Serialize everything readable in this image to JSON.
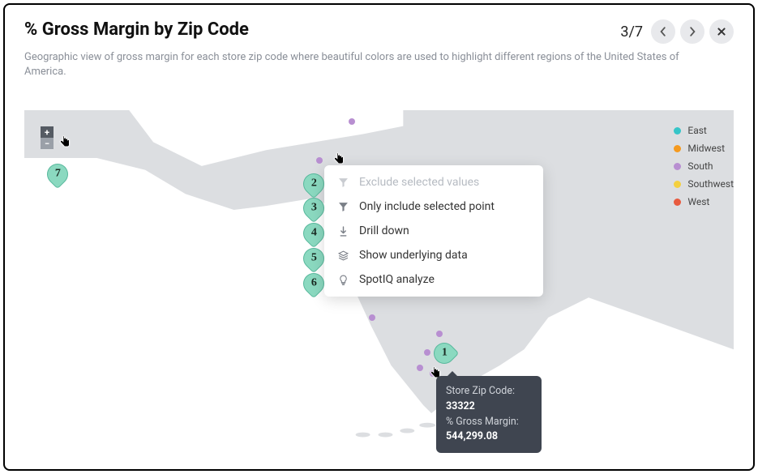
{
  "header": {
    "title": "% Gross Margin by Zip Code",
    "step_indicator": "3/7"
  },
  "subtitle": "Geographic view of gross margin for each store zip code where beautiful colors are used to highlight different regions of the United States of America.",
  "zoom": {
    "in": "+",
    "out": "−"
  },
  "legend": [
    {
      "label": "East",
      "color": "#36c5c8"
    },
    {
      "label": "Midwest",
      "color": "#f59a1f"
    },
    {
      "label": "South",
      "color": "#b88fd1"
    },
    {
      "label": "Southwest",
      "color": "#f4d03f"
    },
    {
      "label": "West",
      "color": "#e85b3f"
    }
  ],
  "pins": {
    "p1": "1",
    "p2": "2",
    "p3": "3",
    "p4": "4",
    "p5": "5",
    "p6": "6",
    "p7": "7"
  },
  "context_menu": {
    "exclude": "Exclude selected values",
    "include": "Only include selected point",
    "drill": "Drill down",
    "underlying": "Show underlying data",
    "spotiq": "SpotIQ analyze"
  },
  "tooltip": {
    "label_zip": "Store Zip Code:",
    "zip": "33322",
    "label_margin": "% Gross Margin:",
    "margin": "544,299.08"
  }
}
